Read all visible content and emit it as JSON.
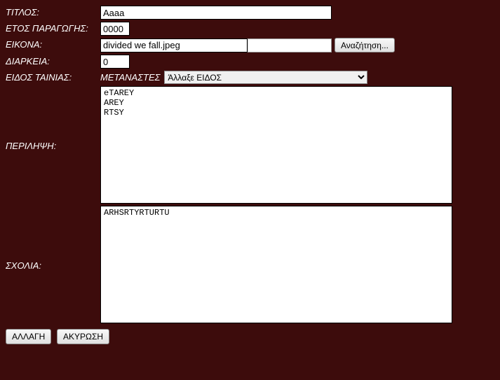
{
  "labels": {
    "title": "ΤΙΤΛΟΣ:",
    "year": "ΕΤΟΣ ΠΑΡΑΓΩΓΗΣ:",
    "image": "ΕΙΚΟΝΑ:",
    "duration": "ΔΙΑΡΚΕΙΑ:",
    "genre": "ΕΙΔΟΣ ΤΑΙΝΙΑΣ:",
    "summary": "ΠΕΡΙΛΗΨΗ:",
    "comments": "ΣΧΟΛΙΑ:"
  },
  "values": {
    "title": "Aaaa",
    "year": "0000",
    "image": "divided we fall.jpeg",
    "duration": "0",
    "genre_current": "ΜΕΤΑΝΑΣΤΕΣ",
    "genre_select": "Άλλαξε ΕΙΔΟΣ",
    "summary": "eTAREY\nAREY\nRTSY",
    "comments": "ARHSRTYRTURTU"
  },
  "buttons": {
    "browse": "Αναζήτηση...",
    "change": "ΑΛΛΑΓΗ",
    "cancel": "ΑΚΥΡΩΣΗ"
  }
}
